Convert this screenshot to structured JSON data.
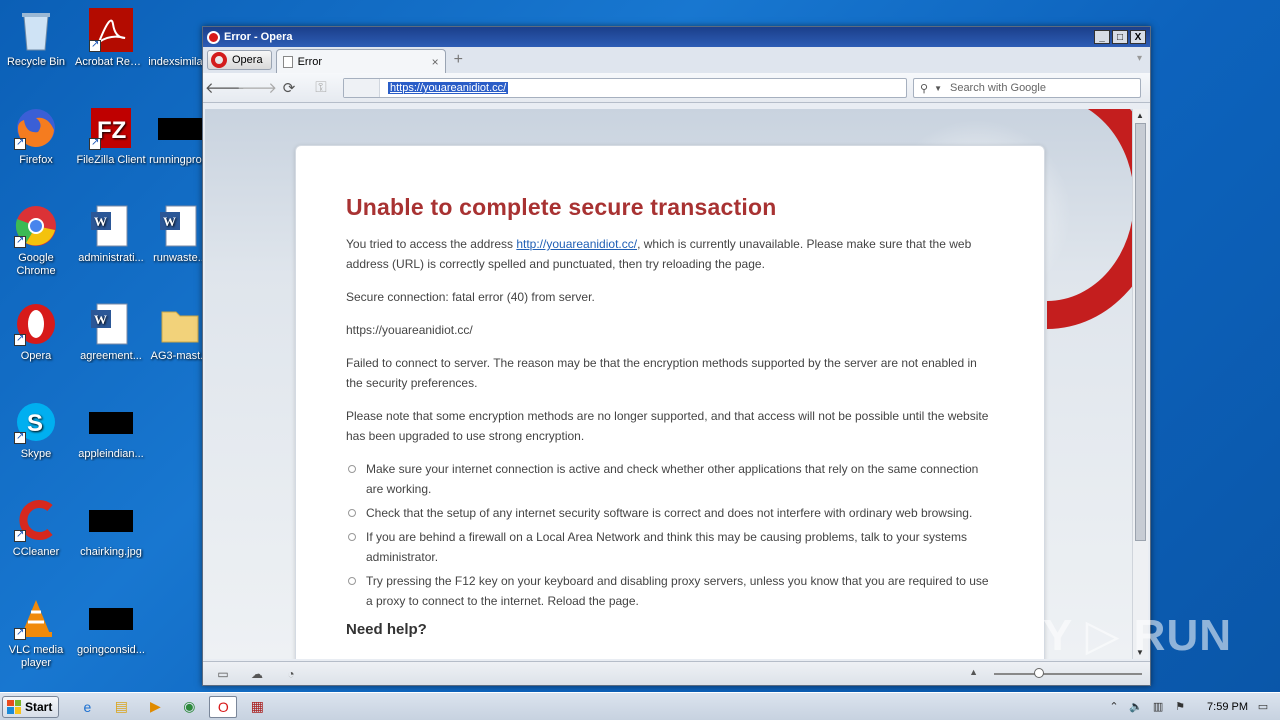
{
  "desktop": {
    "icons": [
      {
        "label": "Recycle Bin"
      },
      {
        "label": "Acrobat Reader DC"
      },
      {
        "label": "indexsimila..."
      },
      {
        "label": "Firefox"
      },
      {
        "label": "FileZilla Client"
      },
      {
        "label": "runningpro..."
      },
      {
        "label": "Google Chrome"
      },
      {
        "label": "administrati..."
      },
      {
        "label": "runwaste..."
      },
      {
        "label": "Opera"
      },
      {
        "label": "agreement..."
      },
      {
        "label": "AG3-mast..."
      },
      {
        "label": "Skype"
      },
      {
        "label": "appleindian..."
      },
      {
        "label": "CCleaner"
      },
      {
        "label": "chairking.jpg"
      },
      {
        "label": "VLC media player"
      },
      {
        "label": "goingconsid..."
      }
    ]
  },
  "window": {
    "title": "Error - Opera",
    "buttons": {
      "minimize": "_",
      "maximize": "□",
      "close": "X"
    }
  },
  "tabs": {
    "menu_label": "Opera",
    "active_tab": "Error",
    "close_glyph": "×",
    "new_tab_glyph": "+"
  },
  "toolbar": {
    "back": "🡐",
    "forward": "🡒",
    "reload": "⟳",
    "key": "⚿",
    "address": "https://youareanidiot.cc/",
    "search_placeholder": "Search with Google"
  },
  "error_page": {
    "heading": "Unable to complete secure transaction",
    "p1_before": "You tried to access the address ",
    "p1_link": "http://youareanidiot.cc/",
    "p1_after": ", which is currently unavailable. Please make sure that the web address (URL) is correctly spelled and punctuated, then try reloading the page.",
    "p2": "Secure connection: fatal error (40) from server.",
    "p3": "https://youareanidiot.cc/",
    "p4": "Failed to connect to server. The reason may be that the encryption methods supported by the server are not enabled in the security preferences.",
    "p5": "Please note that some encryption methods are no longer supported, and that access will not be possible until the website has been upgraded to use strong encryption.",
    "bullets": [
      "Make sure your internet connection is active and check whether other applications that rely on the same connection are working.",
      "Check that the setup of any internet security software is correct and does not interfere with ordinary web browsing.",
      "If you are behind a firewall on a Local Area Network and think this may be causing problems, talk to your systems administrator.",
      "Try pressing the F12 key on your keyboard and disabling proxy servers, unless you know that you are required to use a proxy to connect to the internet. Reload the page."
    ],
    "help_heading": "Need help?"
  },
  "watermark": "ANY ▷ RUN",
  "taskbar": {
    "start_label": "Start",
    "clock": "7:59 PM"
  },
  "colors": {
    "heading": "#a83232",
    "link": "#1f5fb5",
    "opera_red": "#c41e1e",
    "desktop_blue": "#1877d0"
  }
}
